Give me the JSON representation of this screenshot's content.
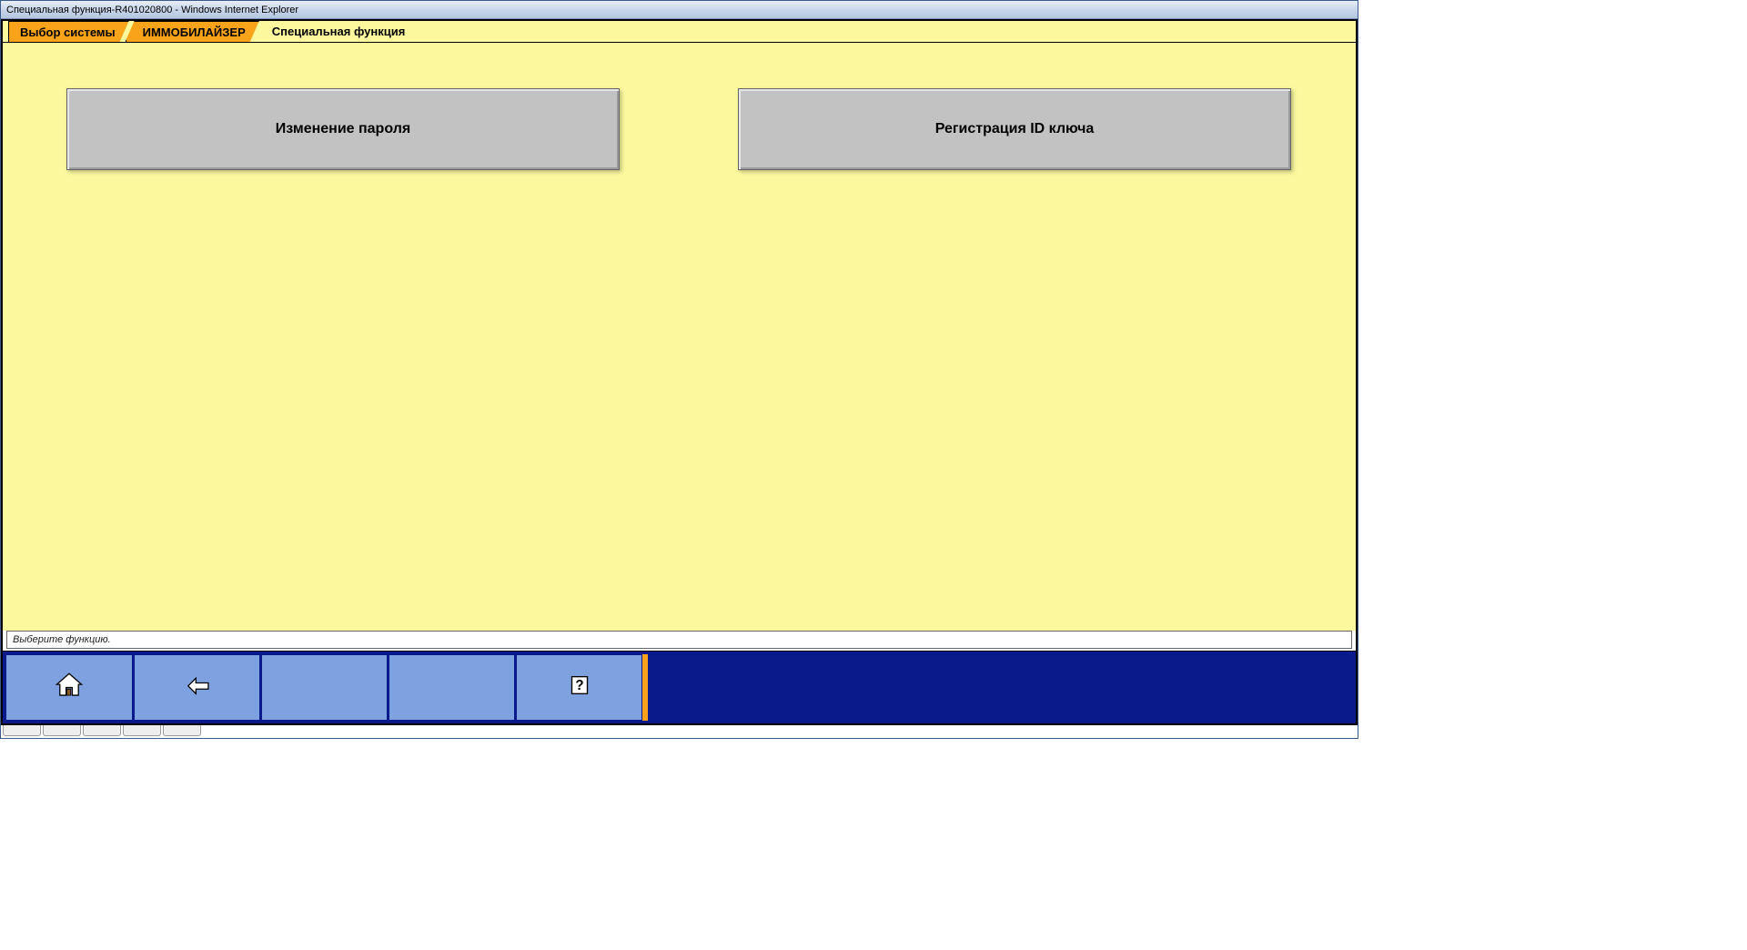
{
  "window": {
    "title": "Специальная функция-R401020800 - Windows Internet Explorer"
  },
  "breadcrumb": {
    "items": [
      {
        "label": "Выбор системы"
      },
      {
        "label": "ИММОБИЛАЙЗЕР"
      }
    ],
    "current": "Специальная функция"
  },
  "buttons": {
    "change_password": "Изменение пароля",
    "register_key_id": "Регистрация ID ключа"
  },
  "status": {
    "text": "Выберите функцию."
  },
  "toolbar": {
    "home": "home",
    "back": "back",
    "help": "help"
  }
}
